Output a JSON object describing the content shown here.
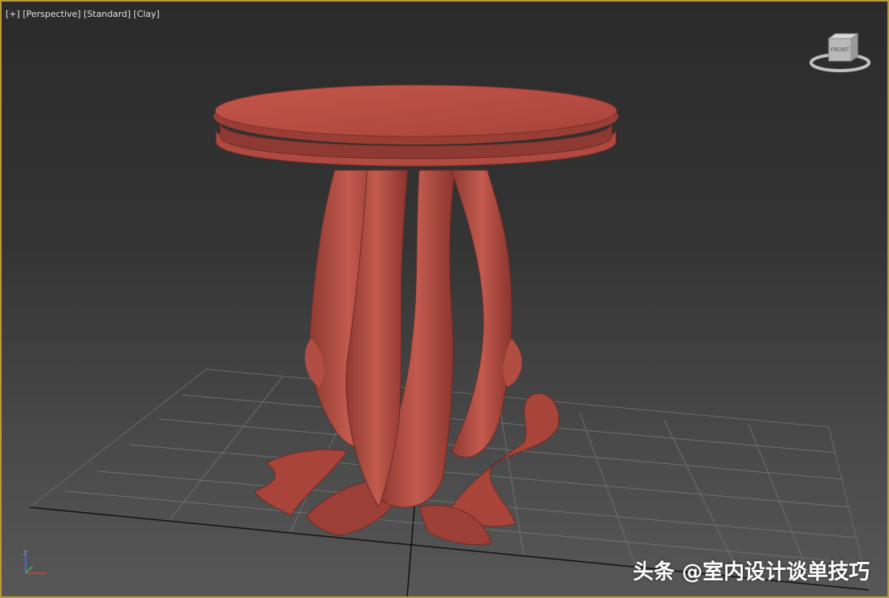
{
  "viewport": {
    "label_plus": "[+]",
    "label_view": "[Perspective]",
    "label_shading": "[Standard]",
    "label_style": "[Clay]",
    "border_color": "#b89a3a",
    "active": true
  },
  "viewcube": {
    "face_label": "FRONT",
    "icon": "viewcube-icon"
  },
  "axis": {
    "z_label": "Z",
    "icon": "axis-tripod-icon"
  },
  "scene": {
    "object": "carved round table",
    "object_color": "#b5473d",
    "grid_color": "#7a7a7a"
  },
  "watermark": {
    "text": "头条 @室内设计谈单技巧"
  }
}
